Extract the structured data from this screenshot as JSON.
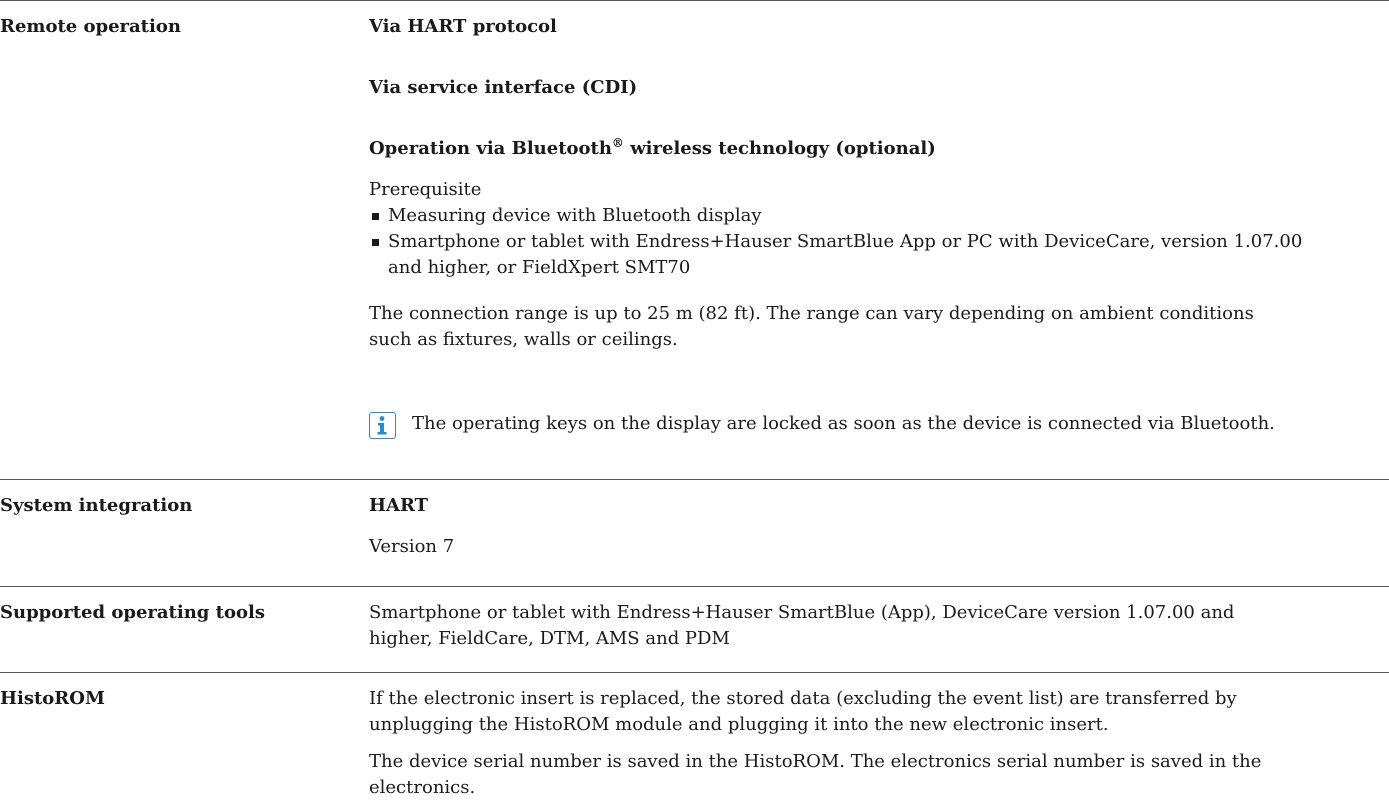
{
  "rows": {
    "remote": {
      "label": "Remote operation",
      "heading_hart": "Via HART protocol",
      "heading_cdi": "Via service interface (CDI)",
      "heading_bt_main": "Operation via Bluetooth",
      "heading_bt_sup": "®",
      "heading_bt_tail": " wireless technology (optional)",
      "prereq_label": "Prerequisite",
      "prereq_items": [
        "Measuring device with Bluetooth display",
        "Smartphone or tablet with Endress+Hauser SmartBlue App or PC with DeviceCare, version 1.07.00",
        "and higher, or FieldXpert SMT70"
      ],
      "range_line1": "The connection range is up to 25 m (82 ft). The range can vary depending on ambient conditions",
      "range_line2": "such as fixtures, walls or ceilings.",
      "note": "The operating keys on the display are locked as soon as the device is connected via Bluetooth.",
      "note_icon": "info-icon"
    },
    "system": {
      "label": "System integration",
      "heading": "HART",
      "text": "Version 7"
    },
    "tools": {
      "label": "Supported operating tools",
      "line1": "Smartphone or tablet with Endress+Hauser SmartBlue (App), DeviceCare version 1.07.00 and",
      "line2": "higher, FieldCare, DTM, AMS and PDM"
    },
    "histo": {
      "label": "HistoROM",
      "p1_line1": "If the electronic insert is replaced, the stored data (excluding the event list) are transferred by",
      "p1_line2": "unplugging the HistoROM module and plugging it into the new electronic insert.",
      "p2_line1": "The device serial number is saved in the HistoROM. The electronics serial number is saved in the",
      "p2_line2": "electronics."
    }
  },
  "colors": {
    "accent_icon": "#1f8fcf",
    "rule": "#555555",
    "text": "#1a1a1a"
  }
}
